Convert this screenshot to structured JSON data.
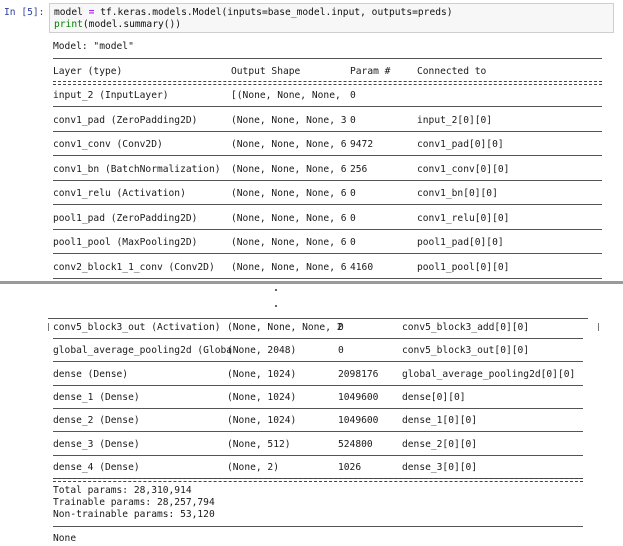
{
  "input_cell": {
    "prompt": "In [5]:",
    "code_lines": [
      [
        "model ",
        "=",
        " tf.keras.models.Model(inputs=base_model.input, outputs=preds)"
      ],
      [
        "",
        "",
        "print(model.summary())"
      ]
    ]
  },
  "summary": {
    "model_label": "Model: \"model\"",
    "headers": {
      "layer": "Layer (type)",
      "output_shape": "Output Shape",
      "params": "Param #",
      "connected": "Connected to"
    },
    "top_rows": [
      {
        "layer": "input_2 (InputLayer)",
        "shape": "[(None, None, None,",
        "params": "0",
        "connected": ""
      },
      {
        "layer": "conv1_pad (ZeroPadding2D)",
        "shape": "(None, None, None, 3",
        "params": "0",
        "connected": "input_2[0][0]"
      },
      {
        "layer": "conv1_conv (Conv2D)",
        "shape": "(None, None, None, 6",
        "params": "9472",
        "connected": "conv1_pad[0][0]"
      },
      {
        "layer": "conv1_bn (BatchNormalization)",
        "shape": "(None, None, None, 6",
        "params": "256",
        "connected": "conv1_conv[0][0]"
      },
      {
        "layer": "conv1_relu (Activation)",
        "shape": "(None, None, None, 6",
        "params": "0",
        "connected": "conv1_bn[0][0]"
      },
      {
        "layer": "pool1_pad (ZeroPadding2D)",
        "shape": "(None, None, None, 6",
        "params": "0",
        "connected": "conv1_relu[0][0]"
      },
      {
        "layer": "pool1_pool (MaxPooling2D)",
        "shape": "(None, None, None, 6",
        "params": "0",
        "connected": "pool1_pad[0][0]"
      },
      {
        "layer": "conv2_block1_1_conv (Conv2D)",
        "shape": "(None, None, None, 6",
        "params": "4160",
        "connected": "pool1_pool[0][0]"
      }
    ],
    "bottom_rows": [
      {
        "layer": "conv5_block3_out (Activation)",
        "shape": "(None, None, None, 2",
        "params": "0",
        "connected": "conv5_block3_add[0][0]"
      },
      {
        "layer": "global_average_pooling2d (Globa",
        "shape": "(None, 2048)",
        "params": "0",
        "connected": "conv5_block3_out[0][0]"
      },
      {
        "layer": "dense (Dense)",
        "shape": "(None, 1024)",
        "params": "2098176",
        "connected": "global_average_pooling2d[0][0]"
      },
      {
        "layer": "dense_1 (Dense)",
        "shape": "(None, 1024)",
        "params": "1049600",
        "connected": "dense[0][0]"
      },
      {
        "layer": "dense_2 (Dense)",
        "shape": "(None, 1024)",
        "params": "1049600",
        "connected": "dense_1[0][0]"
      },
      {
        "layer": "dense_3 (Dense)",
        "shape": "(None, 512)",
        "params": "524800",
        "connected": "dense_2[0][0]"
      },
      {
        "layer": "dense_4 (Dense)",
        "shape": "(None, 2)",
        "params": "1026",
        "connected": "dense_3[0][0]"
      }
    ],
    "totals": {
      "total": "Total params: 28,310,914",
      "trainable": "Trainable params: 28,257,794",
      "non_trainable": "Non-trainable params: 53,120"
    },
    "return_value": "None"
  }
}
